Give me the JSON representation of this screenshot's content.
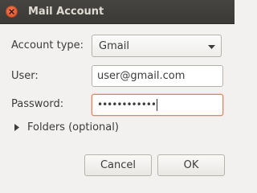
{
  "window": {
    "title": "Mail Account",
    "close_icon": "close-icon"
  },
  "form": {
    "account_type_label": "Account type:",
    "account_type_value": "Gmail",
    "user_label": "User:",
    "user_value": "user@gmail.com",
    "password_label": "Password:",
    "password_value": "••••••••••••",
    "folders_label": "Folders (optional)",
    "folders_expanded": false
  },
  "buttons": {
    "cancel": "Cancel",
    "ok": "OK"
  },
  "colors": {
    "titlebar": "#3c3b37",
    "close": "#e05a30",
    "focus_border": "#e9805f",
    "background": "#f2f1f0"
  }
}
